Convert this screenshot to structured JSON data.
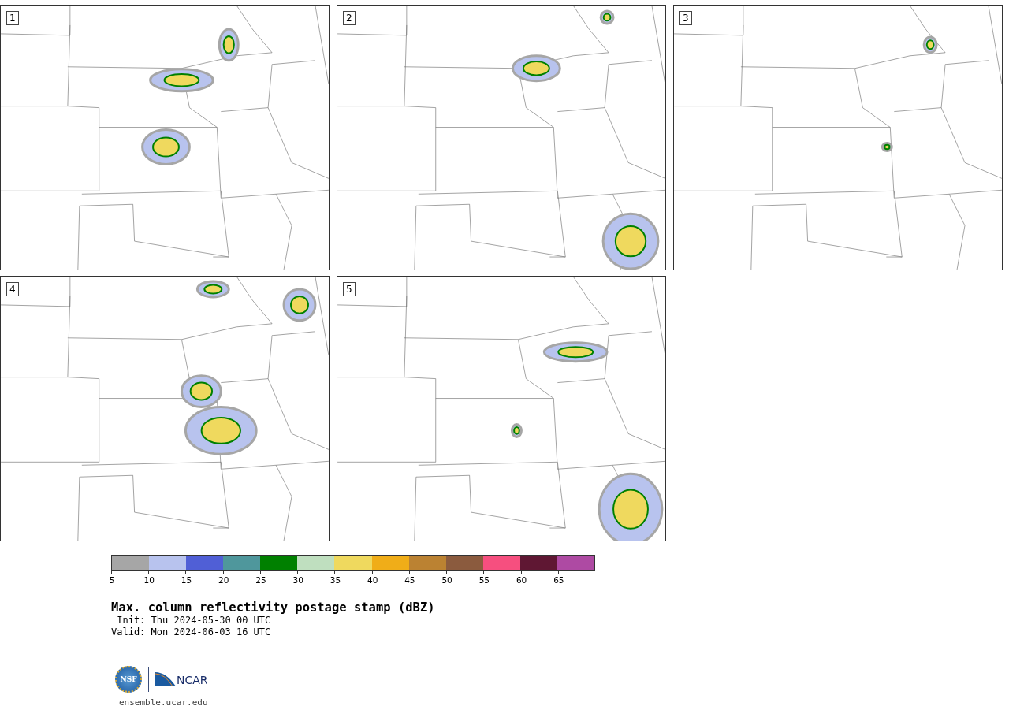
{
  "panels": [
    {
      "label": "1"
    },
    {
      "label": "2"
    },
    {
      "label": "3"
    },
    {
      "label": "4"
    },
    {
      "label": "5"
    }
  ],
  "colorbar": {
    "segments": [
      {
        "color": "#a6a6a6",
        "tick": "5"
      },
      {
        "color": "#b8c3ee",
        "tick": "10"
      },
      {
        "color": "#505fd6",
        "tick": "15"
      },
      {
        "color": "#4f979c",
        "tick": "20"
      },
      {
        "color": "#008000",
        "tick": "25"
      },
      {
        "color": "#bfdfbf",
        "tick": "30"
      },
      {
        "color": "#efd95e",
        "tick": "35"
      },
      {
        "color": "#f0ad18",
        "tick": "40"
      },
      {
        "color": "#bb8232",
        "tick": "45"
      },
      {
        "color": "#8b5b3e",
        "tick": "50"
      },
      {
        "color": "#f64f7f",
        "tick": "55"
      },
      {
        "color": "#5f1733",
        "tick": "60"
      },
      {
        "color": "#ae4aa3",
        "tick": "65"
      }
    ]
  },
  "title": "Max. column reflectivity postage stamp (dBZ)",
  "init": " Init: Thu 2024-05-30 00 UTC",
  "valid": "Valid: Mon 2024-06-03 16 UTC",
  "logos": {
    "nsf": "NSF",
    "ncar": "NCAR"
  },
  "url": "ensemble.ucar.edu"
}
